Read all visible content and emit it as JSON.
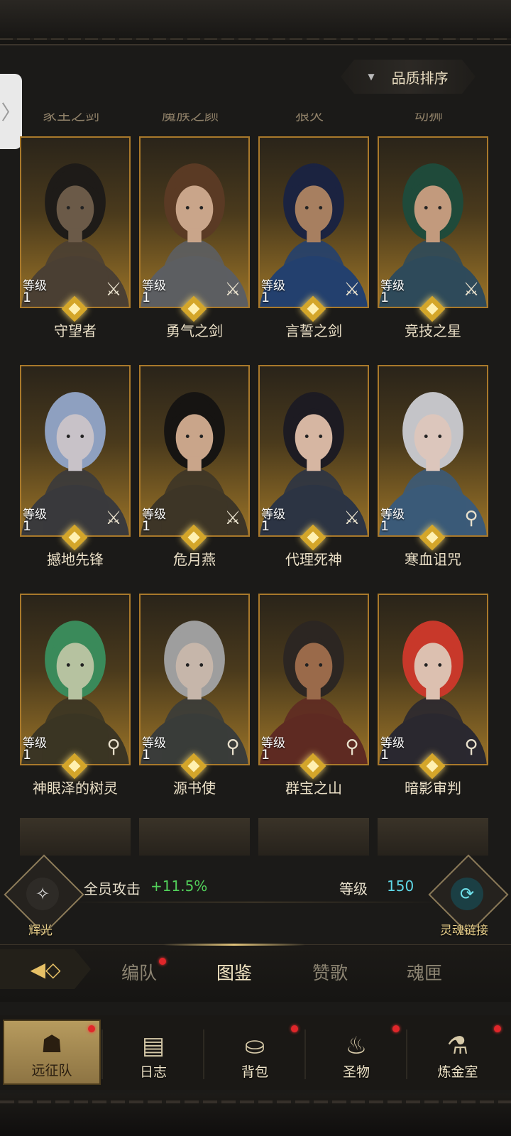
{
  "sort": {
    "label": "品质排序"
  },
  "ghost_names": [
    "家主之剑",
    "魔族之颜",
    "狼灭",
    "动狮"
  ],
  "heroes": [
    {
      "name": "守望者",
      "level_label": "等级",
      "level": "1",
      "class_icon": "sword-icon",
      "skin": "#6b5a48",
      "hair": "#1e1b18",
      "cloth": "#4a3f33"
    },
    {
      "name": "勇气之剑",
      "level_label": "等级",
      "level": "1",
      "class_icon": "sword-icon",
      "skin": "#c9a58a",
      "hair": "#5a3a24",
      "cloth": "#5c5e62"
    },
    {
      "name": "言誓之剑",
      "level_label": "等级",
      "level": "1",
      "class_icon": "sword-icon",
      "skin": "#a77f60",
      "hair": "#1b2340",
      "cloth": "#23406e"
    },
    {
      "name": "竞技之星",
      "level_label": "等级",
      "level": "1",
      "class_icon": "sword-icon",
      "skin": "#c29a7d",
      "hair": "#1f4a3a",
      "cloth": "#2f4a5a"
    },
    {
      "name": "撼地先锋",
      "level_label": "等级",
      "level": "1",
      "class_icon": "sword-icon",
      "skin": "#c8c2c8",
      "hair": "#8ea0c0",
      "cloth": "#3a3a3c"
    },
    {
      "name": "危月燕",
      "level_label": "等级",
      "level": "1",
      "class_icon": "sword-icon",
      "skin": "#c9a58a",
      "hair": "#161412",
      "cloth": "#3d3527"
    },
    {
      "name": "代理死神",
      "level_label": "等级",
      "level": "1",
      "class_icon": "sword-icon",
      "skin": "#d6b6a2",
      "hair": "#1d1b22",
      "cloth": "#2c3444"
    },
    {
      "name": "寒血诅咒",
      "level_label": "等级",
      "level": "1",
      "class_icon": "staff-icon",
      "skin": "#dcc6bc",
      "hair": "#c4c4c8",
      "cloth": "#3b5a78"
    },
    {
      "name": "神眼泽的树灵",
      "level_label": "等级",
      "level": "1",
      "class_icon": "staff-icon",
      "skin": "#b6c2a0",
      "hair": "#3a8a5a",
      "cloth": "#3b3524"
    },
    {
      "name": "源书使",
      "level_label": "等级",
      "level": "1",
      "class_icon": "staff-icon",
      "skin": "#c6b6aa",
      "hair": "#9e9e9e",
      "cloth": "#3a3c3a"
    },
    {
      "name": "群宝之山",
      "level_label": "等级",
      "level": "1",
      "class_icon": "staff-icon",
      "skin": "#9a6a4a",
      "hair": "#2c2622",
      "cloth": "#5e2a22"
    },
    {
      "name": "暗影审判",
      "level_label": "等级",
      "level": "1",
      "class_icon": "staff-icon",
      "skin": "#dcc0b0",
      "hair": "#c8382a",
      "cloth": "#2a2830"
    }
  ],
  "stats": {
    "left_badge_label": "辉光",
    "attack_label": "全员攻击",
    "attack_value": "+11.5%",
    "level_label": "等级",
    "level_value": "150",
    "right_badge_label": "灵魂链接"
  },
  "tabs": [
    {
      "label": "编队",
      "active": false,
      "dot": true
    },
    {
      "label": "图鉴",
      "active": true,
      "dot": false
    },
    {
      "label": "赞歌",
      "active": false,
      "dot": false
    },
    {
      "label": "魂匣",
      "active": false,
      "dot": false
    }
  ],
  "nav": [
    {
      "label": "远征队",
      "icon": "helmet-icon",
      "glyph": "☗",
      "active": true,
      "dot": true
    },
    {
      "label": "日志",
      "icon": "map-icon",
      "glyph": "▤",
      "active": false,
      "dot": false
    },
    {
      "label": "背包",
      "icon": "backpack-icon",
      "glyph": "⛀",
      "active": false,
      "dot": true
    },
    {
      "label": "圣物",
      "icon": "torch-icon",
      "glyph": "♨",
      "active": false,
      "dot": true
    },
    {
      "label": "炼金室",
      "icon": "alchemy-icon",
      "glyph": "⚗",
      "active": false,
      "dot": true
    }
  ],
  "colors": {
    "accent_gold": "#a9792b",
    "attack_green": "#52d05a",
    "level_cyan": "#5fd8e8",
    "badge_red": "#e0262a"
  }
}
